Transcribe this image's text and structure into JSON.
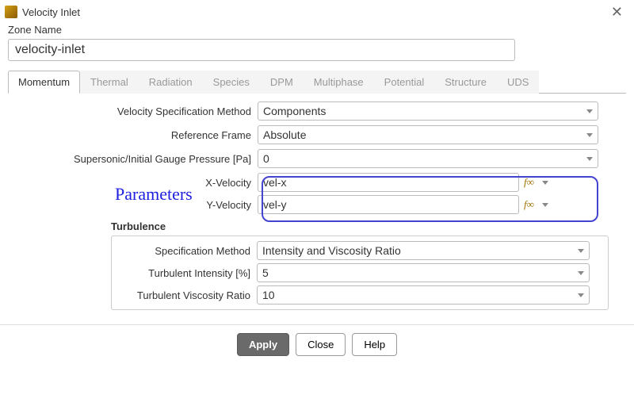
{
  "window": {
    "title": "Velocity Inlet"
  },
  "zone": {
    "label": "Zone Name",
    "value": "velocity-inlet"
  },
  "tabs": [
    {
      "label": "Momentum",
      "active": true
    },
    {
      "label": "Thermal"
    },
    {
      "label": "Radiation"
    },
    {
      "label": "Species"
    },
    {
      "label": "DPM"
    },
    {
      "label": "Multiphase"
    },
    {
      "label": "Potential"
    },
    {
      "label": "Structure"
    },
    {
      "label": "UDS"
    }
  ],
  "momentum": {
    "vel_spec_method": {
      "label": "Velocity Specification Method",
      "value": "Components"
    },
    "ref_frame": {
      "label": "Reference Frame",
      "value": "Absolute"
    },
    "gauge_pressure": {
      "label": "Supersonic/Initial Gauge Pressure [Pa]",
      "value": "0"
    },
    "x_vel": {
      "label": "X-Velocity",
      "value": "vel-x"
    },
    "y_vel": {
      "label": "Y-Velocity",
      "value": "vel-y"
    }
  },
  "annotation": {
    "parameters": "Parameters"
  },
  "turbulence": {
    "header": "Turbulence",
    "spec_method": {
      "label": "Specification Method",
      "value": "Intensity and Viscosity Ratio"
    },
    "intensity": {
      "label": "Turbulent Intensity [%]",
      "value": "5"
    },
    "viscosity_ratio": {
      "label": "Turbulent Viscosity Ratio",
      "value": "10"
    }
  },
  "buttons": {
    "apply": "Apply",
    "close": "Close",
    "help": "Help"
  },
  "fx": "f∞"
}
